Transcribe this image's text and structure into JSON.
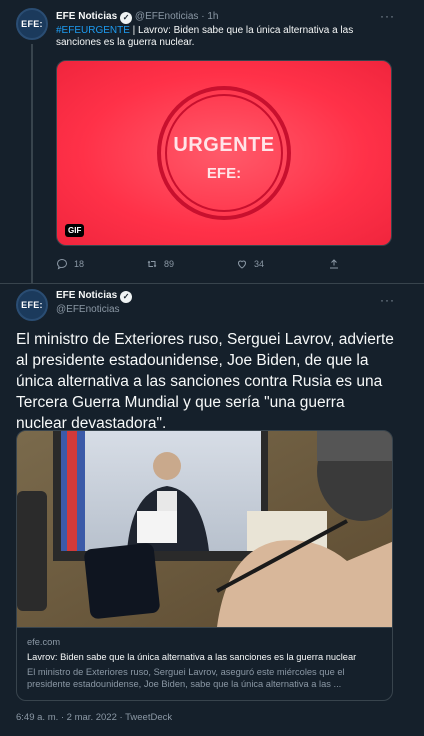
{
  "tweet1": {
    "avatar_text": "EFE:",
    "display_name": "EFE Noticias",
    "handle": "@EFEnoticias",
    "separator": "·",
    "time": "1h",
    "hashtag": "#EFEURGENTE",
    "text": " | Lavrov: Biden sabe que la única alternativa a las sanciones es la guerra nuclear.",
    "media": {
      "stamp_word": "URGENTE",
      "stamp_logo": "EFE:",
      "badge": "GIF"
    },
    "actions": {
      "replies": "18",
      "retweets": "89",
      "likes": "34"
    }
  },
  "tweet2": {
    "avatar_text": "EFE:",
    "display_name": "EFE Noticias",
    "handle": "@EFEnoticias",
    "text": "El ministro de Exteriores ruso, Serguei Lavrov, advierte al presidente estadounidense, Joe Biden, de que la única alternativa a las sanciones contra Rusia es una Tercera Guerra Mundial y que sería \"una guerra nuclear devastadora\".",
    "card": {
      "domain": "efe.com",
      "title": "Lavrov: Biden sabe que la única alternativa a las sanciones es la guerra nuclear",
      "description": "El ministro de Exteriores ruso, Serguei Lavrov, aseguró este miércoles que el presidente estadounidense, Joe Biden, sabe que la única alternativa a las ..."
    },
    "footer": "6:49 a. m. · 2 mar. 2022 · TweetDeck"
  },
  "icons": [
    "reply-icon",
    "retweet-icon",
    "like-icon",
    "share-icon",
    "more-icon",
    "verified-icon"
  ],
  "colors": {
    "background": "#15202b",
    "link": "#1d9bf0",
    "muted": "#8b98a5",
    "urgent_red": "#ff3148"
  }
}
